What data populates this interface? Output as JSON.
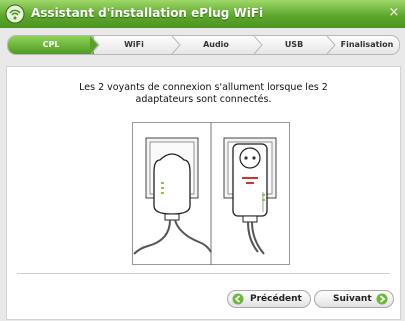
{
  "window": {
    "title": "Assistant d'installation ePlug WiFi",
    "close_glyph": "×"
  },
  "steps": [
    {
      "label": "CPL",
      "active": true
    },
    {
      "label": "WiFi",
      "active": false
    },
    {
      "label": "Audio",
      "active": false
    },
    {
      "label": "USB",
      "active": false
    },
    {
      "label": "Finalisation",
      "active": false
    }
  ],
  "content": {
    "instruction_line1": "Les 2 voyants de connexion s'allument lorsque les 2",
    "instruction_line2": "adaptateurs sont connectés.",
    "illustration_icons": [
      "powerline-adapter-side-icon",
      "powerline-adapter-front-icon"
    ]
  },
  "buttons": {
    "previous_label": "Précédent",
    "next_label": "Suivant"
  },
  "colors": {
    "accent_green": "#5ea82c",
    "active_step_green": "#6bb83a"
  }
}
